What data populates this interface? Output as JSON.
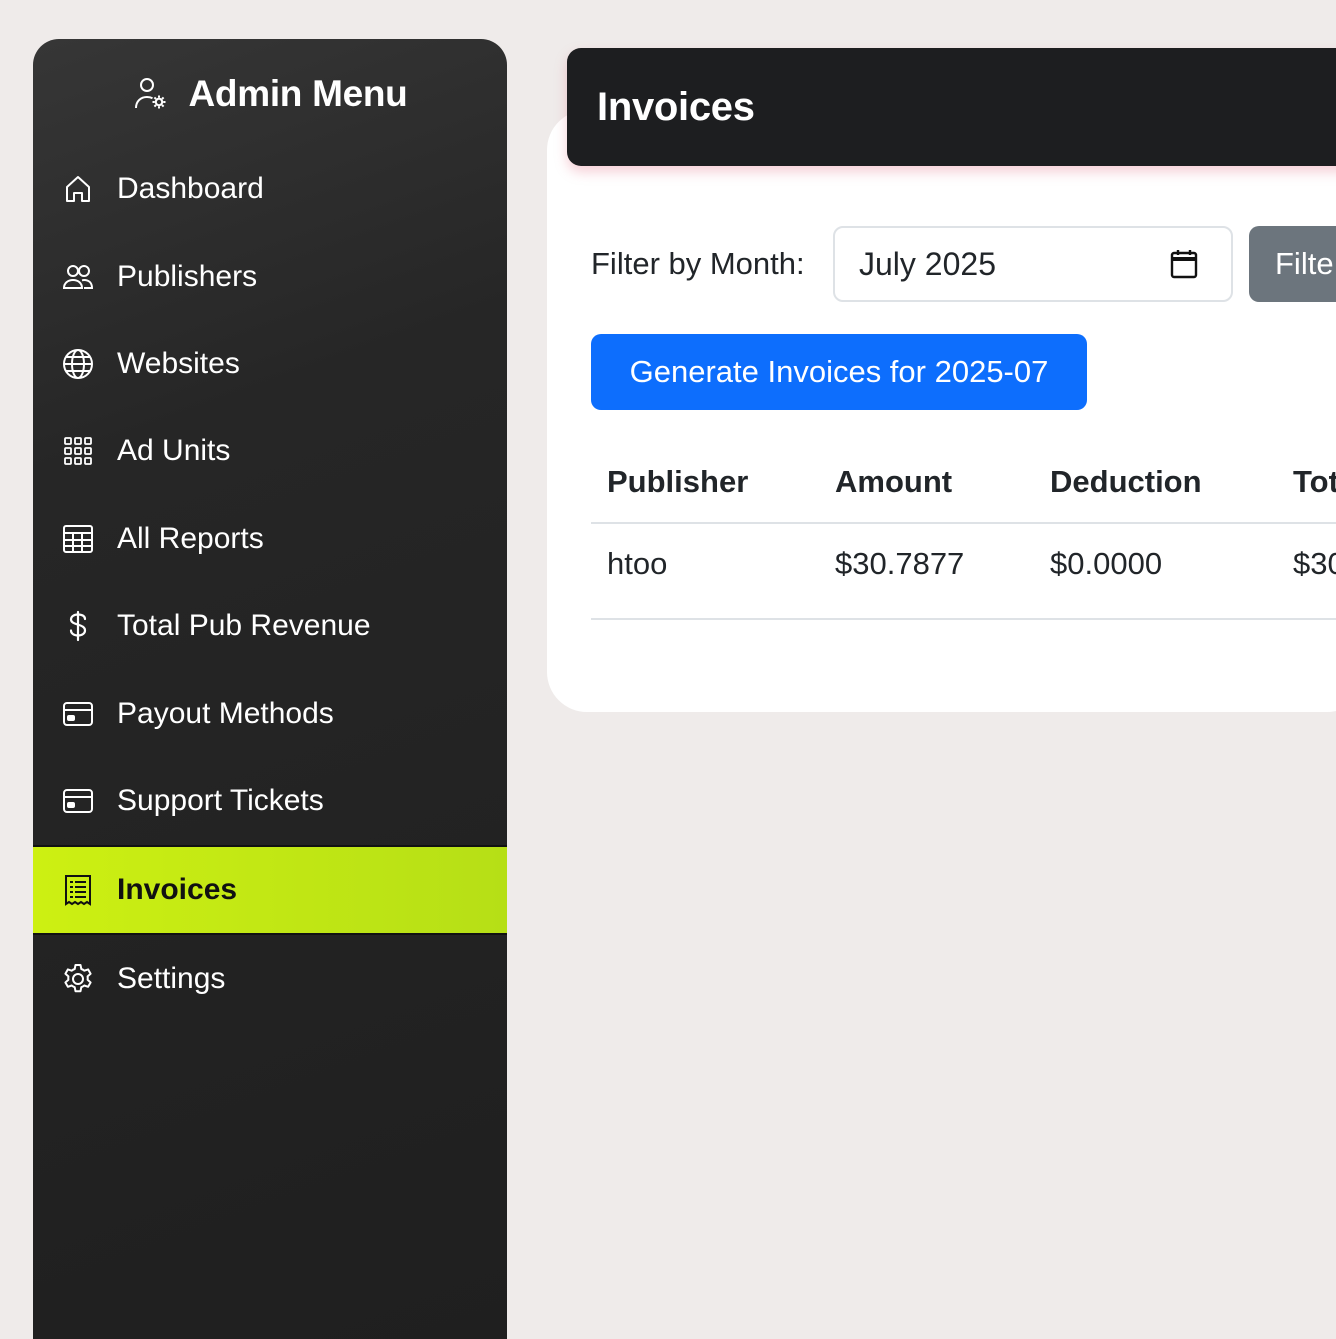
{
  "sidebar": {
    "title": "Admin Menu",
    "header_icon": "user-gear-icon",
    "items": [
      {
        "label": "Dashboard",
        "icon": "house-icon"
      },
      {
        "label": "Publishers",
        "icon": "people-icon"
      },
      {
        "label": "Websites",
        "icon": "globe-icon"
      },
      {
        "label": "Ad Units",
        "icon": "grid-icon"
      },
      {
        "label": "All Reports",
        "icon": "table-icon"
      },
      {
        "label": "Total Pub Revenue",
        "icon": "dollar-icon"
      },
      {
        "label": "Payout Methods",
        "icon": "credit-card-icon"
      },
      {
        "label": "Support Tickets",
        "icon": "credit-card-icon"
      },
      {
        "label": "Invoices",
        "icon": "receipt-icon",
        "active": true
      },
      {
        "label": "Settings",
        "icon": "gear-icon"
      }
    ],
    "active_color": "#c4ea14"
  },
  "header": {
    "title": "Invoices"
  },
  "filter": {
    "label": "Filter by Month:",
    "month_value": "July 2025",
    "button_label": "Filte"
  },
  "generate_button_label": "Generate Invoices for 2025-07",
  "table": {
    "columns": [
      "Publisher",
      "Amount",
      "Deduction",
      "Tot"
    ],
    "rows": [
      [
        "htoo",
        "$30.7877",
        "$0.0000",
        "$30"
      ]
    ]
  },
  "colors": {
    "primary": "#0d6efd",
    "secondary": "#6c757d",
    "topbar": "#1d1e20",
    "sidebar": "#232323"
  }
}
